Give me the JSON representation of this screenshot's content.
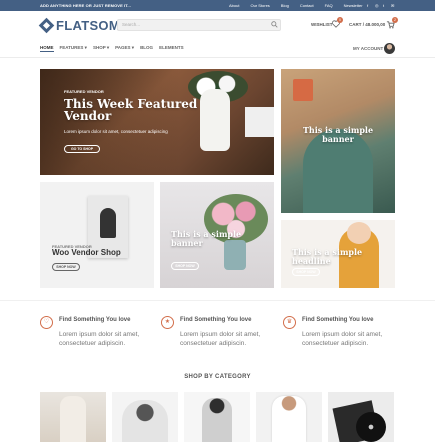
{
  "topbar": {
    "promo": "ADD ANYTHING HERE OR JUST REMOVE IT...",
    "links": [
      "About",
      "Our Stores",
      "Blog",
      "Contact",
      "FAQ",
      "Newsletter"
    ]
  },
  "header": {
    "logo": "FLATSOME",
    "search_placeholder": "Search...",
    "wishlist_label": "WISHLIST",
    "wishlist_count": "0",
    "cart_label": "CART / 48.000,00",
    "cart_count": "2",
    "account_label": "MY ACCOUNT"
  },
  "nav": {
    "items": [
      "HOME",
      "FEATURES",
      "SHOP",
      "PAGES",
      "BLOG",
      "ELEMENTS"
    ]
  },
  "banners": [
    {
      "kicker": "FEATURED VENDOR",
      "title_line1": "This Week Featured",
      "title_line2": "Vendor",
      "subtitle": "Lorem ipsum dolor sit amet, consectetuer adipiscing",
      "button": "GO TO SHOP"
    },
    {
      "title_line1": "This is a simple",
      "title_line2": "banner"
    },
    {
      "kicker": "FEATURED VENDOR",
      "title": "Woo Vendor Shop",
      "button": "SHOP NOW"
    },
    {
      "title_line1": "This is a simple",
      "title_line2": "banner",
      "button": "SHOP NOW"
    },
    {
      "title_line1": "This is a simple",
      "title_line2": "headline",
      "button": "SHOP NOW"
    }
  ],
  "features": [
    {
      "icon": "heart-icon",
      "title": "Find Something You love",
      "text": "Lorem ipsum dolor sit amet, consectetuer adipiscin."
    },
    {
      "icon": "star-icon",
      "title": "Find Something You love",
      "text": "Lorem ipsum dolor sit amet, consectetuer adipiscin."
    },
    {
      "icon": "gift-icon",
      "title": "Find Something You love",
      "text": "Lorem ipsum dolor sit amet, consectetuer adipiscin."
    }
  ],
  "category_title": "SHOP BY CATEGORY",
  "colors": {
    "primary": "#446084",
    "accent": "#d26e4b"
  }
}
